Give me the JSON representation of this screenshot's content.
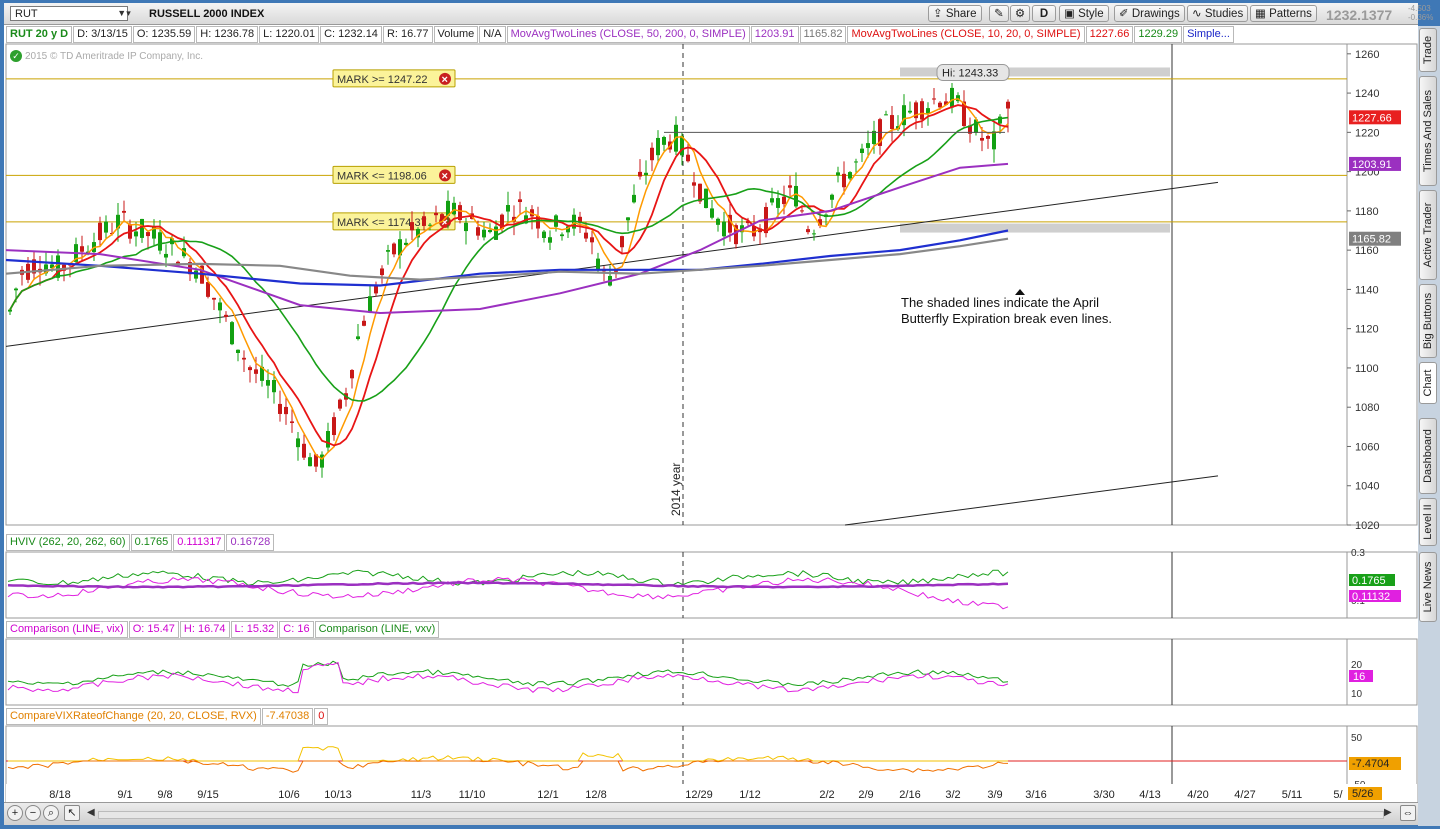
{
  "toolbar": {
    "symbol": "RUT",
    "index_name": "RUSSELL 2000 INDEX",
    "share_label": "Share",
    "period_label": "D",
    "style_label": "Style",
    "drawings_label": "Drawings",
    "studies_label": "Studies",
    "patterns_label": "Patterns",
    "last_price": "1232.1377",
    "change_1": "-4.503",
    "change_2": "-0.36%"
  },
  "header": {
    "chart_label": "RUT 20 y D",
    "date": "D: 3/13/15",
    "open": "O: 1235.59",
    "high": "H: 1236.78",
    "low": "L: 1220.01",
    "close": "C: 1232.14",
    "range": "R: 16.77",
    "volume_label": "Volume",
    "volume_value": "N/A",
    "ma1_label": "MovAvgTwoLines (CLOSE, 50, 200, 0, SIMPLE)",
    "ma1_v1": "1203.91",
    "ma1_v2": "1165.82",
    "ma2_label": "MovAvgTwoLines (CLOSE, 10, 20, 0, SIMPLE)",
    "ma2_v1": "1227.66",
    "ma2_v2": "1229.29",
    "simple_label": "Simple...",
    "copyright": "2015 © TD Ameritrade IP Company, Inc."
  },
  "right_tabs": [
    "Trade",
    "Times And Sales",
    "Active Trader",
    "Big Buttons",
    "Chart",
    "Dashboard",
    "Level II",
    "Live News"
  ],
  "price_pane": {
    "marks": [
      {
        "label": "MARK >= 1247.22",
        "value": 1247.22
      },
      {
        "label": "MARK <= 1198.06",
        "value": 1198.06
      },
      {
        "label": "MARK <= 1174.37",
        "value": 1174.37
      }
    ],
    "hi_label": "Hi: 1243.33",
    "year_label": "2014 year",
    "annotation_line1": "The shaded lines indicate the April",
    "annotation_line2": "Butterfly Expiration break even lines.",
    "price_badges": [
      {
        "text": "1227.66",
        "value": 1227.66,
        "color": "#e82020"
      },
      {
        "text": "1203.91",
        "value": 1203.91,
        "color": "#9b30c0"
      },
      {
        "text": "1165.82",
        "value": 1165.82,
        "color": "#808080"
      }
    ]
  },
  "hviv_pane": {
    "label": "HVIV (262, 20, 262, 60)",
    "v1": "0.1765",
    "v2": "0.111317",
    "v3": "0.16728",
    "badge1": "0.1765",
    "badge2": "0.11132",
    "tick_top": "0.3",
    "tick_bottom": "0.1"
  },
  "comparison_pane": {
    "label1": "Comparison (LINE, vix)",
    "open": "O: 15.47",
    "high": "H: 16.74",
    "low": "L: 15.32",
    "close": "C: 16",
    "label2": "Comparison (LINE, vxv)",
    "badge": "16",
    "ticks": [
      "20",
      "10"
    ]
  },
  "roc_pane": {
    "label": "CompareVIXRateofChange (20, 20, CLOSE, RVX)",
    "value": "-7.47038",
    "zero": "0",
    "badge": "-7.4704",
    "ticks": [
      "50",
      "-50"
    ]
  },
  "x_axis": {
    "labels": [
      "8/18",
      "9/1",
      "9/8",
      "9/15",
      "10/6",
      "10/13",
      "11/3",
      "11/10",
      "12/1",
      "12/8",
      "12/29",
      "1/12",
      "2/2",
      "2/9",
      "2/16",
      "3/2",
      "3/9",
      "3/16",
      "3/30",
      "4/13",
      "4/20",
      "4/27",
      "5/11",
      "5/"
    ],
    "end_badge": "5/26"
  },
  "colors": {
    "sma10": "#ff9a00",
    "sma20": "#e81515",
    "sma50": "#18a018",
    "sma200_purple": "#9b30c0",
    "blue": "#1f2fd0",
    "gray": "#888888",
    "up": "#12a012",
    "down": "#c81818",
    "mark_fill": "#fbf39a"
  },
  "chart_data": {
    "type": "candlestick",
    "title": "RUSSELL 2000 INDEX",
    "ylim": [
      1020,
      1265
    ],
    "y_ticks": [
      1020,
      1040,
      1060,
      1080,
      1100,
      1120,
      1140,
      1160,
      1180,
      1200,
      1220,
      1240,
      1260
    ],
    "ohlc_key_points": [
      {
        "date": "8/11",
        "close": 1128
      },
      {
        "date": "8/18",
        "close": 1150
      },
      {
        "date": "9/1",
        "close": 1172
      },
      {
        "date": "9/8",
        "close": 1165
      },
      {
        "date": "9/15",
        "close": 1150
      },
      {
        "date": "10/6",
        "close": 1085
      },
      {
        "date": "10/13",
        "close": 1050
      },
      {
        "date": "11/3",
        "close": 1168
      },
      {
        "date": "11/10",
        "close": 1180
      },
      {
        "date": "12/1",
        "close": 1170
      },
      {
        "date": "12/8",
        "close": 1150
      },
      {
        "date": "12/29",
        "close": 1210
      },
      {
        "date": "1/12",
        "close": 1165
      },
      {
        "date": "2/2",
        "close": 1180
      },
      {
        "date": "2/9",
        "close": 1210
      },
      {
        "date": "2/16",
        "close": 1230
      },
      {
        "date": "3/2",
        "close": 1238
      },
      {
        "date": "3/9",
        "close": 1215
      },
      {
        "date": "3/13",
        "open": 1235.59,
        "high": 1236.78,
        "low": 1220.01,
        "close": 1232.14
      }
    ],
    "series": [
      {
        "name": "SMA 50",
        "last": 1203.91
      },
      {
        "name": "SMA 200",
        "last": 1165.82
      },
      {
        "name": "SMA 10",
        "last": 1227.66
      },
      {
        "name": "SMA 20",
        "last": 1229.29
      }
    ]
  }
}
